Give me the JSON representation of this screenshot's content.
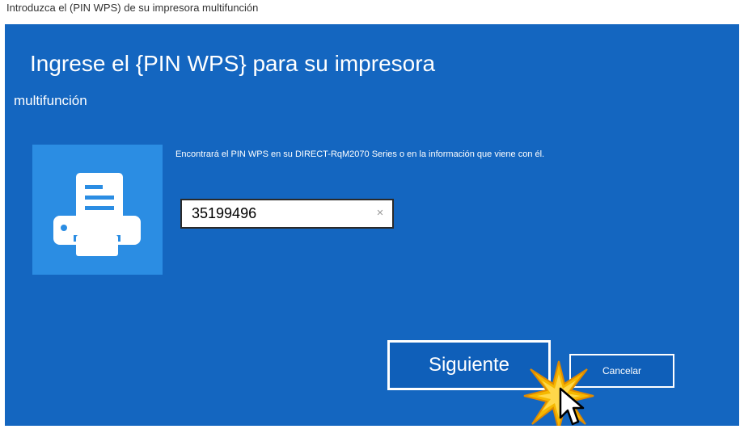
{
  "caption": "Introduzca el (PIN WPS) de su impresora multifunción",
  "dialog": {
    "title": "Ingrese el {PIN WPS} para su impresora",
    "title_continuation": "multifunción",
    "instruction": "Encontrará el PIN WPS en su DIRECT-RqM2070 Series o en la información que viene con él.",
    "pin_value": "35199496",
    "next_label": "Siguiente",
    "cancel_label": "Cancelar"
  },
  "icons": {
    "device": "printer-icon",
    "clear": "clear-icon",
    "cursor": "mouse-pointer-icon",
    "click": "click-burst-icon"
  },
  "colors": {
    "dialog_bg": "#1466c0",
    "tile_bg": "#2b8de3",
    "button_bg": "#0f5fb9",
    "text": "#ffffff",
    "highlight": "#f5b800"
  }
}
